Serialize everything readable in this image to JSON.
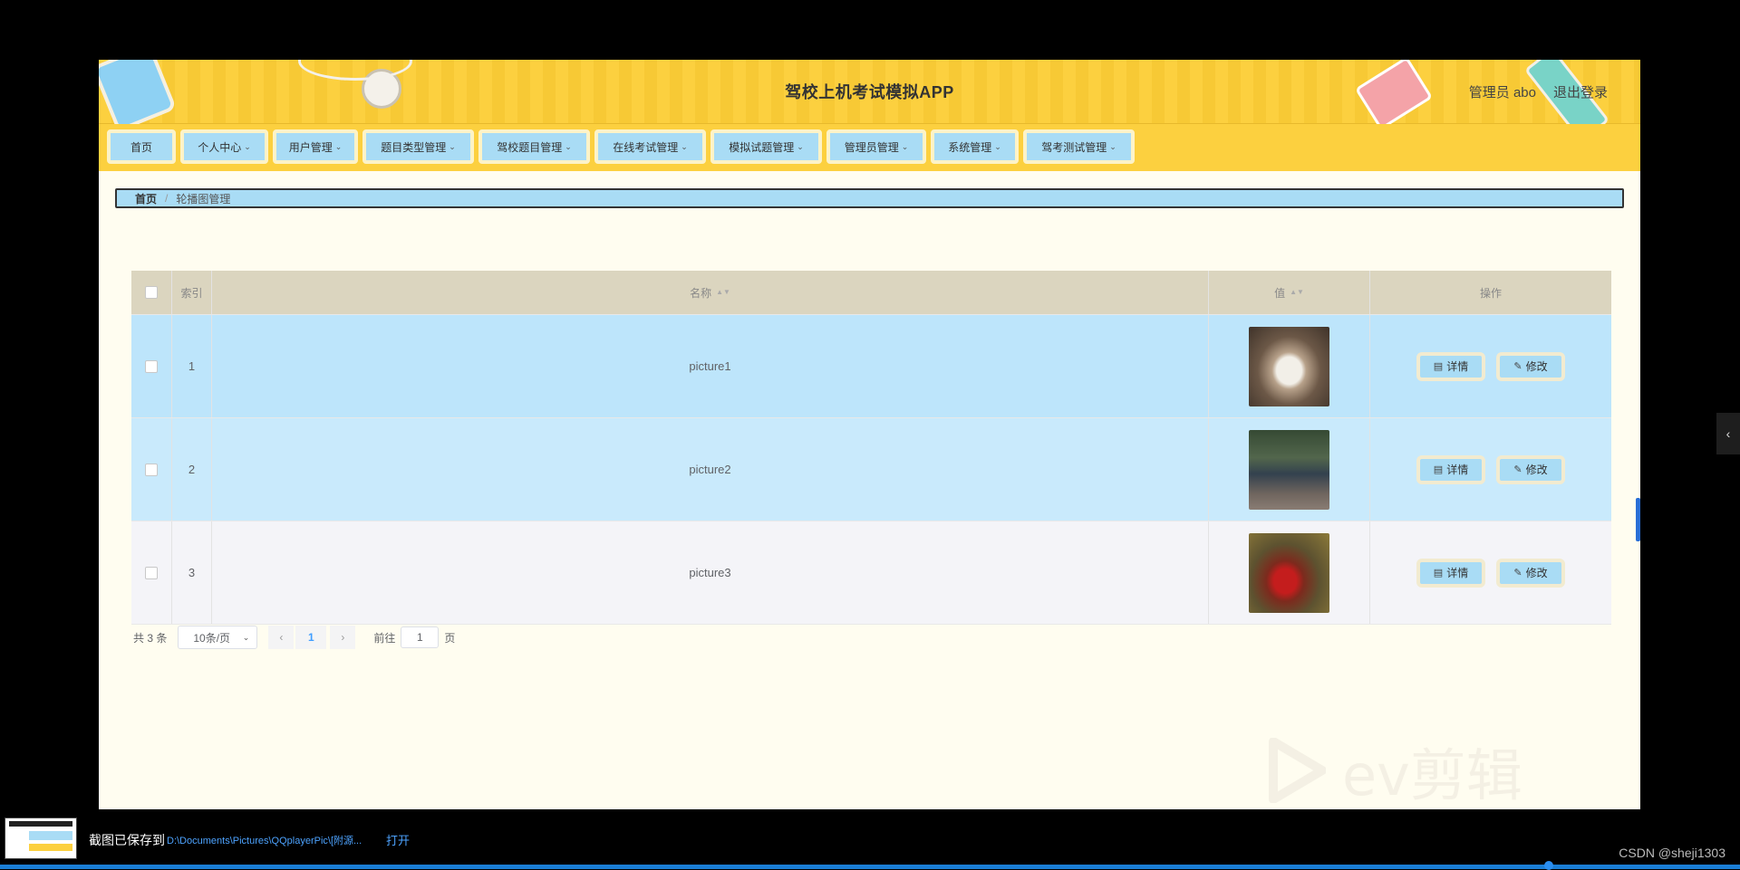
{
  "header": {
    "title": "驾校上机考试模拟APP",
    "user_info": "管理员 abo",
    "logout_label": "退出登录"
  },
  "nav": {
    "items": [
      {
        "label": "首页",
        "has_dropdown": false
      },
      {
        "label": "个人中心",
        "has_dropdown": true
      },
      {
        "label": "用户管理",
        "has_dropdown": true
      },
      {
        "label": "题目类型管理",
        "has_dropdown": true
      },
      {
        "label": "驾校题目管理",
        "has_dropdown": true
      },
      {
        "label": "在线考试管理",
        "has_dropdown": true
      },
      {
        "label": "模拟试题管理",
        "has_dropdown": true
      },
      {
        "label": "管理员管理",
        "has_dropdown": true
      },
      {
        "label": "系统管理",
        "has_dropdown": true
      },
      {
        "label": "驾考测试管理",
        "has_dropdown": true
      }
    ],
    "chevron_icon": "chevron-down-icon"
  },
  "breadcrumb": {
    "home": "首页",
    "separator": "/",
    "current": "轮播图管理"
  },
  "table": {
    "columns": {
      "index": "索引",
      "name": "名称",
      "value": "值",
      "actions": "操作"
    },
    "rows": [
      {
        "index": "1",
        "name": "picture1",
        "value_image": "car-photo-white-rally"
      },
      {
        "index": "2",
        "name": "picture2",
        "value_image": "car-photo-dark-forest"
      },
      {
        "index": "3",
        "name": "picture3",
        "value_image": "car-photo-red-forest"
      }
    ],
    "detail_label": "详情",
    "edit_label": "修改"
  },
  "pagination": {
    "total": "共 3 条",
    "page_size": "10条/页",
    "current_page": "1",
    "goto_label": "前往",
    "goto_value": "1",
    "page_unit": "页"
  },
  "watermark": {
    "text": "ev剪辑"
  },
  "notification": {
    "message": "截图已保存到",
    "path": "D:\\Documents\\Pictures\\QQplayerPic\\[附源...",
    "open_label": "打开"
  },
  "credit": "CSDN @sheji1303",
  "colors": {
    "header_yellow": "#fcd03f",
    "nav_button_blue": "#a9dcf5",
    "header_row": "#dbd5bf",
    "row_blue": "#bde5fb",
    "content_bg": "#fffdf0"
  }
}
